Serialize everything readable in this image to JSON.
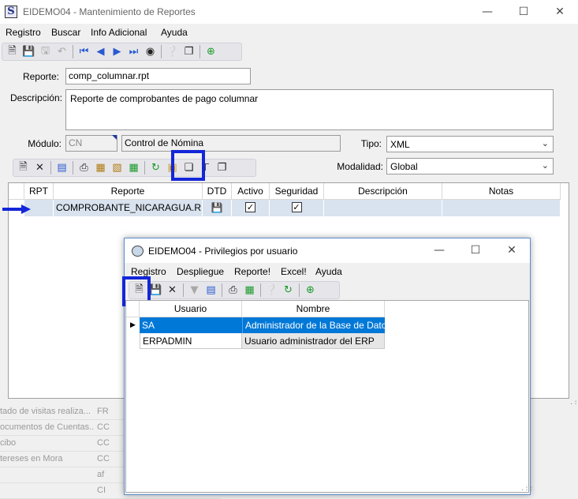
{
  "main_window": {
    "app_icon_letter": "S",
    "title": "EIDEMO04 - Mantenimiento de Reportes",
    "menu": [
      "Registro",
      "Buscar",
      "Info Adicional",
      "Ayuda"
    ],
    "form": {
      "reporte_label": "Reporte:",
      "reporte_value": "comp_columnar.rpt",
      "descripcion_label": "Descripción:",
      "descripcion_value": "Reporte de comprobantes de pago columnar",
      "modulo_label": "Módulo:",
      "modulo_code": "CN",
      "modulo_name": "Control de Nómina",
      "tipo_label": "Tipo:",
      "tipo_value": "XML",
      "modalidad_label": "Modalidad:",
      "modalidad_value": "Global"
    },
    "grid": {
      "columns": [
        "RPT",
        "Reporte",
        "DTD",
        "Activo",
        "Seguridad",
        "Descripción",
        "Notas"
      ],
      "row": {
        "reporte": "COMPROBANTE_NICARAGUA.RPT",
        "activo_check": "✓",
        "seguridad_check": "✓"
      }
    }
  },
  "background_list": [
    {
      "c1": "tado de visitas realiza...",
      "c2": "FR"
    },
    {
      "c1": "ocumentos de Cuentas...",
      "c2": "CC"
    },
    {
      "c1": "cibo",
      "c2": "CC"
    },
    {
      "c1": "tereses en Mora",
      "c2": "CC"
    },
    {
      "c1": "",
      "c2": "af"
    },
    {
      "c1": "",
      "c2": "CI"
    }
  ],
  "dialog": {
    "title": "EIDEMO04 - Privilegios por usuario",
    "menu": [
      "Registro",
      "Despliegue",
      "Reporte!",
      "Excel!",
      "Ayuda"
    ],
    "columns": [
      "Usuario",
      "Nombre"
    ],
    "rows": [
      {
        "usuario": "SA",
        "nombre": "Administrador de la Base de Datos"
      },
      {
        "usuario": "ERPADMIN",
        "nombre": "Usuario administrador del ERP"
      }
    ]
  },
  "icons": {
    "minimize": "minimize-icon",
    "maximize": "maximize-icon",
    "close": "close-icon",
    "arrow_annotation": "arrow-right-icon"
  },
  "colors": {
    "highlight": "#1426d8",
    "selection": "#0078d7",
    "row_bg": "#d9e3ef"
  }
}
